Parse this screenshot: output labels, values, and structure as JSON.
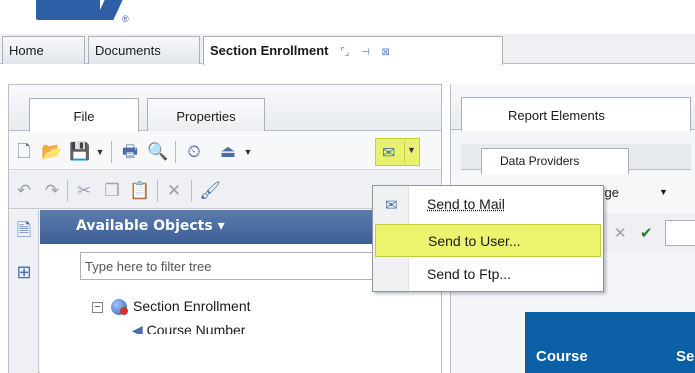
{
  "colors": {
    "accent": "#2d5fa6",
    "highlight": "#ecf46e",
    "report_header": "#0b5fa5"
  },
  "doc_tabs": [
    {
      "label": "Home"
    },
    {
      "label": "Documents"
    },
    {
      "label": "Section Enrollment"
    }
  ],
  "left_tabs": {
    "file": "File",
    "properties": "Properties"
  },
  "right_tabs": {
    "report_elements": "Report Elements",
    "data_providers": "Data Providers"
  },
  "toolbar_icons": [
    "new-document-icon",
    "open-icon",
    "save-icon",
    "print-icon",
    "find-icon",
    "schedule-icon",
    "export-icon",
    "mail-icon"
  ],
  "send_menu": {
    "items": [
      {
        "label": "Send to Mail",
        "icon": "mail-icon"
      },
      {
        "label": "Send to User...",
        "icon": ""
      },
      {
        "label": "Send to Ftp...",
        "icon": ""
      }
    ]
  },
  "objects": {
    "title": "Available Objects",
    "title_arrow": "▾",
    "filter_placeholder": "Type here to filter tree",
    "tree": [
      {
        "label": "Section Enrollment"
      },
      {
        "label": "Course Number"
      }
    ]
  },
  "right": {
    "purge_label": "urge",
    "columns": [
      "Course",
      "Se"
    ]
  }
}
